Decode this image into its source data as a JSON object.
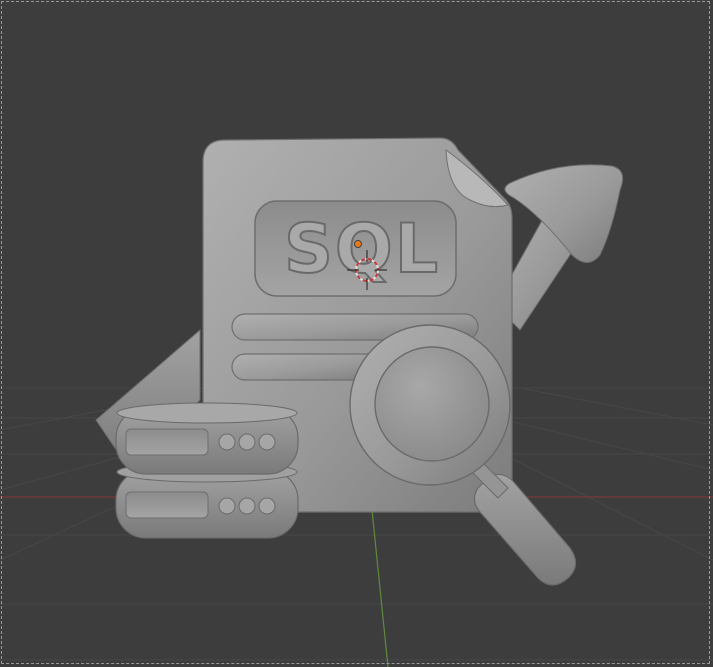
{
  "viewport": {
    "background": "#3d3d3d",
    "grid_color": "#474747",
    "x_axis_color": "#7a3a3a",
    "y_axis_color": "#5f8a3f",
    "origin_color": "#e07a1f"
  },
  "model": {
    "label_text": "SQL",
    "clay_color": "#9a9a9a",
    "icons": [
      "sql-document-icon",
      "database-icon",
      "magnifier-icon",
      "trend-arrow-icon"
    ]
  }
}
